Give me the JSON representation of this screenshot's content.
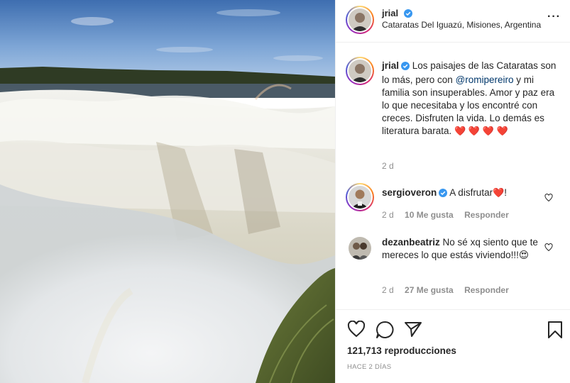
{
  "post": {
    "username": "jrial",
    "location": "Cataratas Del Iguazú, Misiones, Argentina",
    "caption_before_mention": "Los paisajes de las Cataratas son lo más, pero con ",
    "mention": "@romipereiro",
    "caption_after_mention": " y mi familia son insuperables. Amor y paz era lo que necesitaba y los encontré con creces. Disfruten la vida. Lo demás es literatura barata.",
    "caption_hearts_line1": "❤️ ❤️",
    "caption_hearts_line2": "❤️ ❤️",
    "caption_age": "2 d",
    "views": "121,713",
    "views_label": "reproducciones",
    "posted_ago": "HACE 2 DÍAS"
  },
  "comments": [
    {
      "username": "sergioveron",
      "text": "A disfrutar",
      "text_suffix": "!",
      "heart": "❤️",
      "age": "2 d",
      "likes": "10 Me gusta",
      "reply_label": "Responder"
    },
    {
      "username": "dezanbeatriz",
      "text": "No sé xq siento que te mereces lo que estás viviendo!!!",
      "emoji": "😍",
      "age": "2 d",
      "likes": "27 Me gusta",
      "reply_label": "Responder"
    }
  ],
  "icons": {
    "more": "more-options-icon",
    "like": "heart-icon",
    "comment": "comment-bubble-icon",
    "share": "paper-plane-icon",
    "save": "bookmark-icon",
    "verified": "verified-badge-icon"
  },
  "colors": {
    "verified": "#3897f0",
    "mention": "#00376b",
    "secondary_text": "#8e8e8e",
    "heart": "#ed1c24"
  }
}
